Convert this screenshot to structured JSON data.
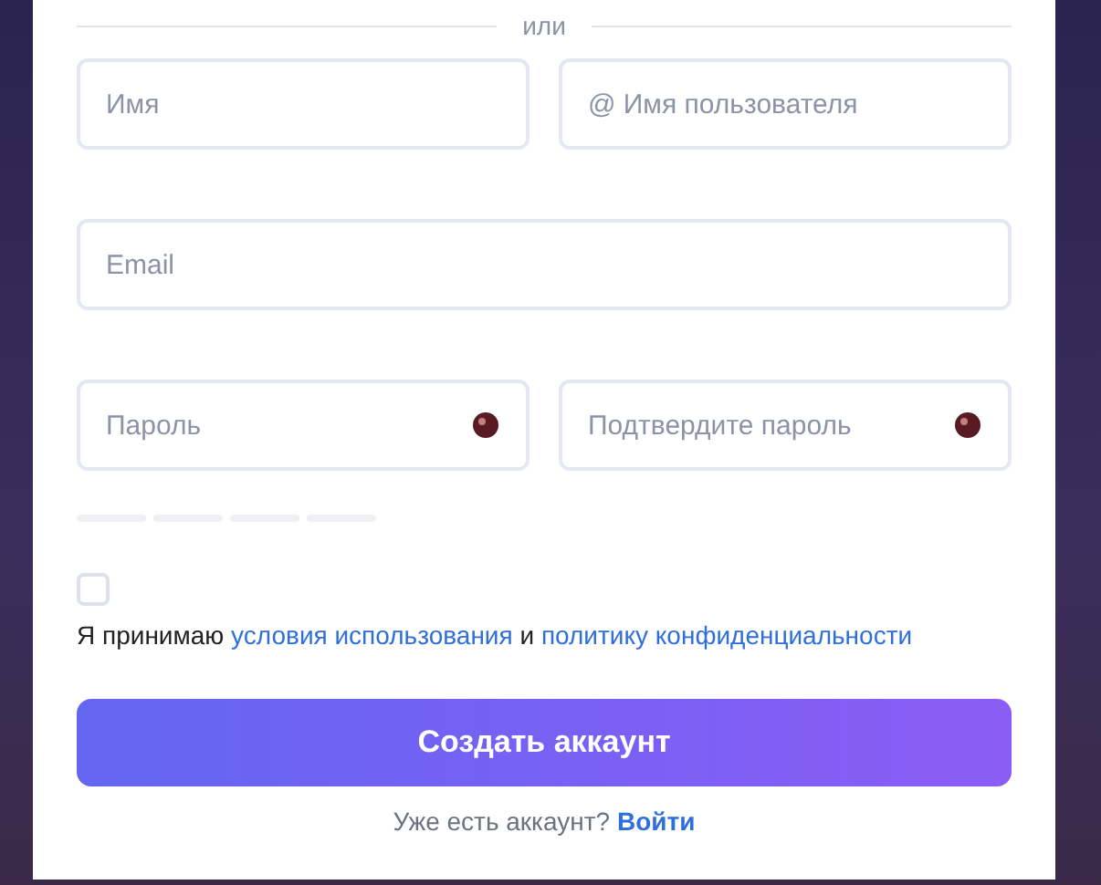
{
  "divider": {
    "label": "или"
  },
  "fields": [
    {
      "kind": "text",
      "placeholder": "Имя"
    },
    {
      "kind": "text",
      "placeholder": "@ Имя пользователя"
    },
    {
      "kind": "wide",
      "placeholder": "Email"
    },
    {
      "kind": "password",
      "placeholder": "Пароль"
    },
    {
      "kind": "password",
      "placeholder": "Подтвердите пароль"
    }
  ],
  "terms": {
    "checked": false,
    "text_before": "Я принимаю",
    "link_1": "условия использования",
    "text_middle": "и",
    "link_2": "политику конфиденциальности"
  },
  "submit": {
    "label": "Создать аккаунт"
  },
  "footer": {
    "text": "Уже есть аккаунт?",
    "link": "Войти"
  }
}
